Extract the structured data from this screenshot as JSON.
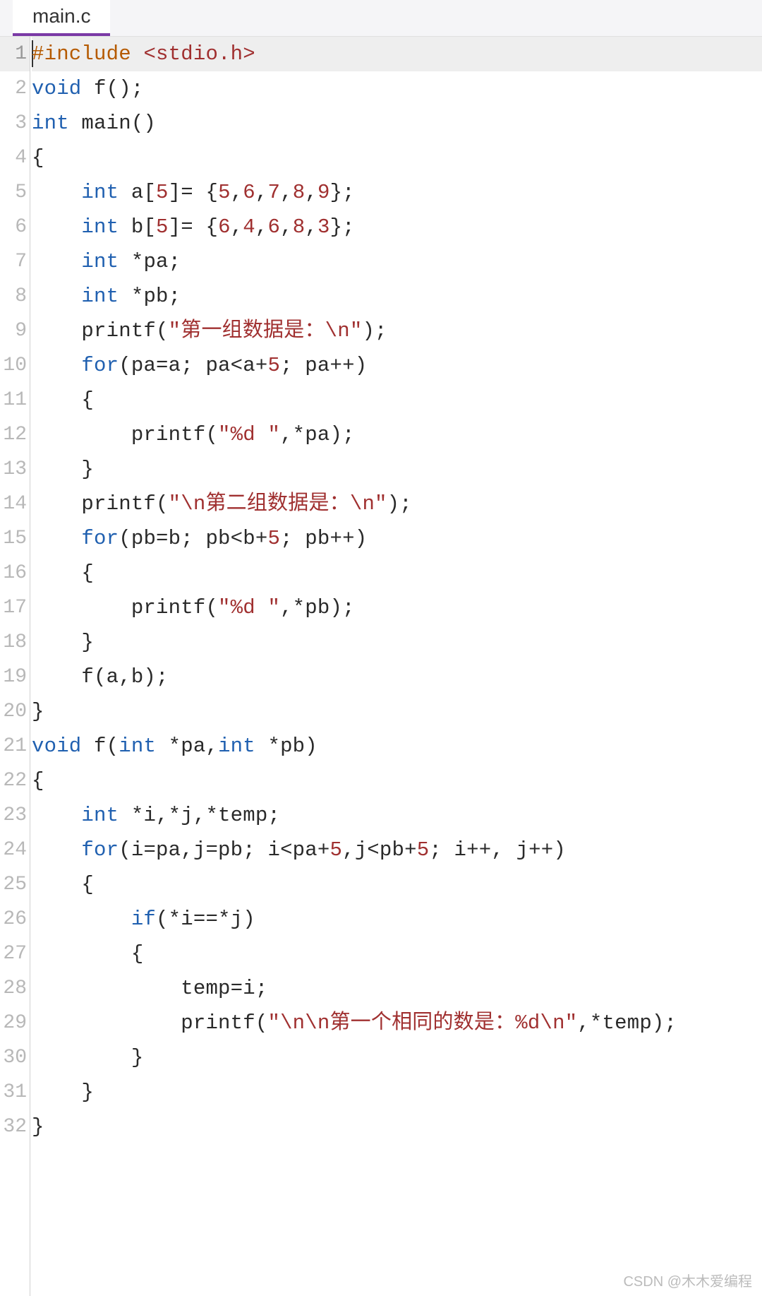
{
  "tab": {
    "filename": "main.c"
  },
  "watermark": "CSDN @木木爱编程",
  "syntax_colors": {
    "keyword": "#2060b0",
    "preprocessor": "#b55a00",
    "string_number_include": "#a03030",
    "text": "#2a2a2a",
    "gutter": "#b8b8b8",
    "highlight_bg": "#eeeeee",
    "tab_accent": "#7b3aa6"
  },
  "highlighted_line": 1,
  "code_lines": [
    {
      "n": 1,
      "tokens": [
        [
          "pp",
          "#include"
        ],
        [
          "",
          ""
        ],
        [
          "id",
          " "
        ],
        [
          "inc",
          "<stdio.h>"
        ]
      ]
    },
    {
      "n": 2,
      "tokens": [
        [
          "kw",
          "void"
        ],
        [
          "id",
          " f();"
        ]
      ]
    },
    {
      "n": 3,
      "tokens": [
        [
          "kw",
          "int"
        ],
        [
          "id",
          " main()"
        ]
      ]
    },
    {
      "n": 4,
      "tokens": [
        [
          "id",
          "{"
        ]
      ]
    },
    {
      "n": 5,
      "tokens": [
        [
          "id",
          "    "
        ],
        [
          "kw",
          "int"
        ],
        [
          "id",
          " a["
        ],
        [
          "num",
          "5"
        ],
        [
          "id",
          "]= {"
        ],
        [
          "num",
          "5"
        ],
        [
          "id",
          ","
        ],
        [
          "num",
          "6"
        ],
        [
          "id",
          ","
        ],
        [
          "num",
          "7"
        ],
        [
          "id",
          ","
        ],
        [
          "num",
          "8"
        ],
        [
          "id",
          ","
        ],
        [
          "num",
          "9"
        ],
        [
          "id",
          "};"
        ]
      ]
    },
    {
      "n": 6,
      "tokens": [
        [
          "id",
          "    "
        ],
        [
          "kw",
          "int"
        ],
        [
          "id",
          " b["
        ],
        [
          "num",
          "5"
        ],
        [
          "id",
          "]= {"
        ],
        [
          "num",
          "6"
        ],
        [
          "id",
          ","
        ],
        [
          "num",
          "4"
        ],
        [
          "id",
          ","
        ],
        [
          "num",
          "6"
        ],
        [
          "id",
          ","
        ],
        [
          "num",
          "8"
        ],
        [
          "id",
          ","
        ],
        [
          "num",
          "3"
        ],
        [
          "id",
          "};"
        ]
      ]
    },
    {
      "n": 7,
      "tokens": [
        [
          "id",
          "    "
        ],
        [
          "kw",
          "int"
        ],
        [
          "id",
          " *pa;"
        ]
      ]
    },
    {
      "n": 8,
      "tokens": [
        [
          "id",
          "    "
        ],
        [
          "kw",
          "int"
        ],
        [
          "id",
          " *pb;"
        ]
      ]
    },
    {
      "n": 9,
      "tokens": [
        [
          "id",
          "    printf("
        ],
        [
          "str",
          "\"第一组数据是：\\n\""
        ],
        [
          "id",
          ");"
        ]
      ]
    },
    {
      "n": 10,
      "tokens": [
        [
          "id",
          "    "
        ],
        [
          "kw",
          "for"
        ],
        [
          "id",
          "(pa=a; pa<a+"
        ],
        [
          "num",
          "5"
        ],
        [
          "id",
          "; pa++)"
        ]
      ]
    },
    {
      "n": 11,
      "tokens": [
        [
          "id",
          "    {"
        ]
      ]
    },
    {
      "n": 12,
      "tokens": [
        [
          "id",
          "        printf("
        ],
        [
          "str",
          "\"%d \""
        ],
        [
          "id",
          ",*pa);"
        ]
      ]
    },
    {
      "n": 13,
      "tokens": [
        [
          "id",
          "    }"
        ]
      ]
    },
    {
      "n": 14,
      "tokens": [
        [
          "id",
          "    printf("
        ],
        [
          "str",
          "\"\\n第二组数据是：\\n\""
        ],
        [
          "id",
          ");"
        ]
      ]
    },
    {
      "n": 15,
      "tokens": [
        [
          "id",
          "    "
        ],
        [
          "kw",
          "for"
        ],
        [
          "id",
          "(pb=b; pb<b+"
        ],
        [
          "num",
          "5"
        ],
        [
          "id",
          "; pb++)"
        ]
      ]
    },
    {
      "n": 16,
      "tokens": [
        [
          "id",
          "    {"
        ]
      ]
    },
    {
      "n": 17,
      "tokens": [
        [
          "id",
          "        printf("
        ],
        [
          "str",
          "\"%d \""
        ],
        [
          "id",
          ",*pb);"
        ]
      ]
    },
    {
      "n": 18,
      "tokens": [
        [
          "id",
          "    }"
        ]
      ]
    },
    {
      "n": 19,
      "tokens": [
        [
          "id",
          "    f(a,b);"
        ]
      ]
    },
    {
      "n": 20,
      "tokens": [
        [
          "id",
          "}"
        ]
      ]
    },
    {
      "n": 21,
      "tokens": [
        [
          "kw",
          "void"
        ],
        [
          "id",
          " f("
        ],
        [
          "kw",
          "int"
        ],
        [
          "id",
          " *pa,"
        ],
        [
          "kw",
          "int"
        ],
        [
          "id",
          " *pb)"
        ]
      ]
    },
    {
      "n": 22,
      "tokens": [
        [
          "id",
          "{"
        ]
      ]
    },
    {
      "n": 23,
      "tokens": [
        [
          "id",
          "    "
        ],
        [
          "kw",
          "int"
        ],
        [
          "id",
          " *i,*j,*temp;"
        ]
      ]
    },
    {
      "n": 24,
      "tokens": [
        [
          "id",
          "    "
        ],
        [
          "kw",
          "for"
        ],
        [
          "id",
          "(i=pa,j=pb; i<pa+"
        ],
        [
          "num",
          "5"
        ],
        [
          "id",
          ",j<pb+"
        ],
        [
          "num",
          "5"
        ],
        [
          "id",
          "; i++, j++)"
        ]
      ]
    },
    {
      "n": 25,
      "tokens": [
        [
          "id",
          "    {"
        ]
      ]
    },
    {
      "n": 26,
      "tokens": [
        [
          "id",
          "        "
        ],
        [
          "kw",
          "if"
        ],
        [
          "id",
          "(*i==*j)"
        ]
      ]
    },
    {
      "n": 27,
      "tokens": [
        [
          "id",
          "        {"
        ]
      ]
    },
    {
      "n": 28,
      "tokens": [
        [
          "id",
          "            temp=i;"
        ]
      ]
    },
    {
      "n": 29,
      "tokens": [
        [
          "id",
          "            printf("
        ],
        [
          "str",
          "\"\\n\\n第一个相同的数是：%d\\n\""
        ],
        [
          "id",
          ",*temp);"
        ]
      ]
    },
    {
      "n": 30,
      "tokens": [
        [
          "id",
          "        }"
        ]
      ]
    },
    {
      "n": 31,
      "tokens": [
        [
          "id",
          "    }"
        ]
      ]
    },
    {
      "n": 32,
      "tokens": [
        [
          "id",
          "}"
        ]
      ]
    }
  ]
}
